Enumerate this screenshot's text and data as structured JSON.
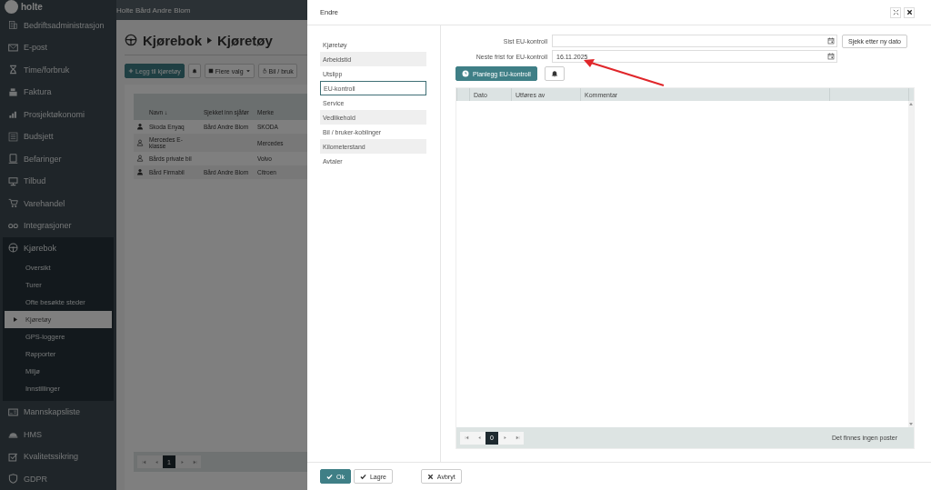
{
  "app": {
    "logo": "holte",
    "user": "Holte Bård Andre Blom"
  },
  "sidebar": {
    "items": [
      {
        "label": "Bedriftsadministrasjon"
      },
      {
        "label": "E-post"
      },
      {
        "label": "Time/forbruk"
      },
      {
        "label": "Faktura"
      },
      {
        "label": "Prosjektøkonomi"
      },
      {
        "label": "Budsjett"
      },
      {
        "label": "Befaringer"
      },
      {
        "label": "Tilbud"
      },
      {
        "label": "Varehandel"
      },
      {
        "label": "Integrasjoner"
      },
      {
        "label": "Kjørebok",
        "expanded": true,
        "children": [
          {
            "label": "Oversikt",
            "selected": false
          },
          {
            "label": "Turer",
            "selected": false
          },
          {
            "label": "Ofte besøkte steder",
            "selected": false
          },
          {
            "label": "Kjøretøy",
            "selected": true
          },
          {
            "label": "GPS-loggere",
            "selected": false
          },
          {
            "label": "Rapporter",
            "selected": false
          },
          {
            "label": "Miljø",
            "selected": false
          },
          {
            "label": "Innstillinger",
            "selected": false
          }
        ]
      },
      {
        "label": "Mannskapsliste"
      },
      {
        "label": "HMS"
      },
      {
        "label": "Kvalitetssikring"
      },
      {
        "label": "GDPR"
      }
    ]
  },
  "page": {
    "breadcrumb": [
      "Kjørebok",
      "Kjøretøy"
    ],
    "toolbar": {
      "add": "Legg til kjøretøy",
      "more": "Flere valg",
      "links": "Bil / bruk"
    },
    "table": {
      "columns": [
        "Navn",
        "Sjekket inn sjåfør",
        "Merke"
      ],
      "sort_mark": "↓",
      "rows": [
        {
          "name": "Skoda Enyaq",
          "driver": "Bård Andre Blom",
          "brand": "SKODA",
          "checked_in": true
        },
        {
          "name": "Mercedes E-klasse",
          "brand": "Mercedes",
          "checked_in": false
        },
        {
          "name": "Bårds private bil",
          "brand": "Volvo",
          "checked_in": false
        },
        {
          "name": "Bård Firmabil",
          "driver": "Bård Andre Blom",
          "brand": "Citroen",
          "checked_in": true
        }
      ]
    },
    "pager": {
      "page": "1"
    }
  },
  "dialog": {
    "title": "Endre",
    "nav": [
      {
        "label": "Kjøretøy",
        "selected": false
      },
      {
        "label": "Arbeidstid",
        "selected": false
      },
      {
        "label": "Utslipp",
        "selected": false
      },
      {
        "label": "EU-kontroll",
        "selected": true
      },
      {
        "label": "Service",
        "selected": false
      },
      {
        "label": "Vedlikehold",
        "selected": false
      },
      {
        "label": "Bil / bruker-koblinger",
        "selected": false
      },
      {
        "label": "Kilometerstand",
        "selected": false
      },
      {
        "label": "Avtaler",
        "selected": false
      }
    ],
    "fields": [
      {
        "label": "Sist EU-kontroll"
      },
      {
        "label": "Neste frist for EU-kontroll",
        "value": "16.11.2025"
      }
    ],
    "check_button": "Sjekk etter ny dato",
    "plan_button": "Planlegg EU-kontroll",
    "table": {
      "columns": [
        "Dato",
        "Utføres av",
        "Kommentar"
      ]
    },
    "pager": {
      "page": "0",
      "status": "Det finnes ingen poster"
    },
    "footer": {
      "ok": "Ok",
      "save": "Lagre",
      "cancel": "Avbryt"
    }
  }
}
